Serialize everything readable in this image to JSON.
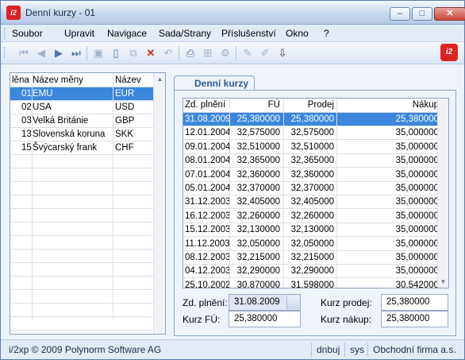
{
  "window": {
    "title": "Denní kurzy - 01",
    "app_icon": "i/2 logo"
  },
  "menu": [
    "Soubor",
    "Upravit",
    "Navigace",
    "Sada/Strany",
    "Příslušenství",
    "Okno",
    "?"
  ],
  "left": {
    "headers": [
      "lěna",
      "Název měny",
      "Název"
    ],
    "rows": [
      {
        "code": "01",
        "name": "EMU",
        "abbr": "EUR"
      },
      {
        "code": "02",
        "name": "USA",
        "abbr": "USD"
      },
      {
        "code": "03",
        "name": "Velká Británie",
        "abbr": "GBP"
      },
      {
        "code": "13",
        "name": "Slovenská koruna",
        "abbr": "SKK"
      },
      {
        "code": "15",
        "name": "Švýcarský frank",
        "abbr": "CHF"
      }
    ]
  },
  "tab": {
    "label": "Denní kurzy"
  },
  "grid": {
    "headers": [
      "Zd. plnění",
      "FÚ",
      "Prodej",
      "Nákup"
    ],
    "rows": [
      [
        "31.08.2009",
        "25,380000",
        "25,380000",
        "25,380000"
      ],
      [
        "12.01.2004",
        "32,575000",
        "32,575000",
        "35,000000"
      ],
      [
        "09.01.2004",
        "32,510000",
        "32,510000",
        "35,000000"
      ],
      [
        "08.01.2004",
        "32,365000",
        "32,365000",
        "35,000000"
      ],
      [
        "07.01.2004",
        "32,360000",
        "32,360000",
        "35,000000"
      ],
      [
        "05.01.2004",
        "32,370000",
        "32,370000",
        "35,000000"
      ],
      [
        "31.12.2003",
        "32,405000",
        "32,405000",
        "35,000000"
      ],
      [
        "16.12.2003",
        "32,260000",
        "32,260000",
        "35,000000"
      ],
      [
        "15.12.2003",
        "32,130000",
        "32,130000",
        "35,000000"
      ],
      [
        "11.12.2003",
        "32,050000",
        "32,050000",
        "35,000000"
      ],
      [
        "08.12.2003",
        "32,215000",
        "32,215000",
        "35,000000"
      ],
      [
        "04.12.2003",
        "32,290000",
        "32,290000",
        "35,000000"
      ],
      [
        "25.10.2002",
        "30,870000",
        "31,598000",
        "30,542000"
      ]
    ]
  },
  "form": {
    "zd_plneni_label": "Zd. plnění:",
    "zd_plneni_value": "31.08.2009",
    "kurz_fu_label": "Kurz FÚ:",
    "kurz_fu_value": "25,380000",
    "kurz_prodej_label": "Kurz prodej:",
    "kurz_prodej_value": "25,380000",
    "kurz_nakup_label": "Kurz nákup:",
    "kurz_nakup_value": "25,380000"
  },
  "status": {
    "copyright": "i/2xp © 2009 Polynorm Software AG",
    "db": "dnbuj",
    "user": "sys",
    "company": "Obchodní firma a.s."
  },
  "colors": {
    "selection": "#3a87dc",
    "tab_text": "#2a5d9b"
  }
}
